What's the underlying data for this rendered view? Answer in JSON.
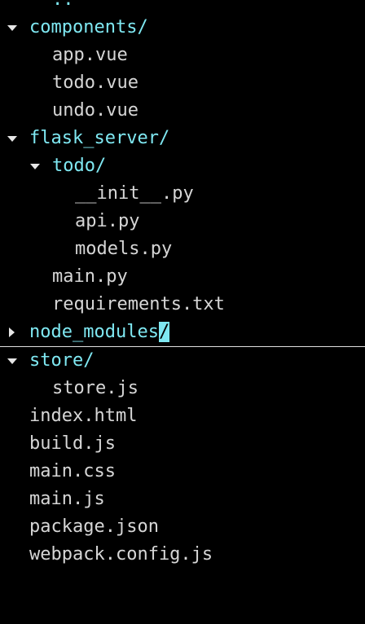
{
  "colors": {
    "background": "#000000",
    "directory": "#7fe8f2",
    "file": "#d6d6d6",
    "cursor": "#7fe8f2"
  },
  "tree": {
    "items": [
      {
        "label": "..",
        "kind": "dir-partial",
        "depth": 1
      },
      {
        "label": "components/",
        "kind": "dir",
        "state": "expanded",
        "depth": 0
      },
      {
        "label": "app.vue",
        "kind": "file",
        "depth": 1
      },
      {
        "label": "todo.vue",
        "kind": "file",
        "depth": 1
      },
      {
        "label": "undo.vue",
        "kind": "file",
        "depth": 1
      },
      {
        "label": "flask_server/",
        "kind": "dir",
        "state": "expanded",
        "depth": 0
      },
      {
        "label": "todo/",
        "kind": "dir",
        "state": "expanded",
        "depth": 1
      },
      {
        "label": "__init__.py",
        "kind": "file",
        "depth": 2
      },
      {
        "label": "api.py",
        "kind": "file",
        "depth": 2
      },
      {
        "label": "models.py",
        "kind": "file",
        "depth": 2
      },
      {
        "label": "main.py",
        "kind": "file",
        "depth": 1
      },
      {
        "label": "requirements.txt",
        "kind": "file",
        "depth": 1
      },
      {
        "label": "node_modules",
        "cursor_char": "/",
        "kind": "dir",
        "state": "collapsed",
        "depth": 0,
        "selected": true
      },
      {
        "label": "store/",
        "kind": "dir",
        "state": "expanded",
        "depth": 0
      },
      {
        "label": "store.js",
        "kind": "file",
        "depth": 1
      },
      {
        "label": "index.html",
        "kind": "file",
        "depth": 0
      },
      {
        "label": "build.js",
        "kind": "file",
        "depth": 0
      },
      {
        "label": "main.css",
        "kind": "file",
        "depth": 0
      },
      {
        "label": "main.js",
        "kind": "file",
        "depth": 0
      },
      {
        "label": "package.json",
        "kind": "file",
        "depth": 0
      },
      {
        "label": "webpack.config.js",
        "kind": "file",
        "depth": 0
      }
    ]
  }
}
